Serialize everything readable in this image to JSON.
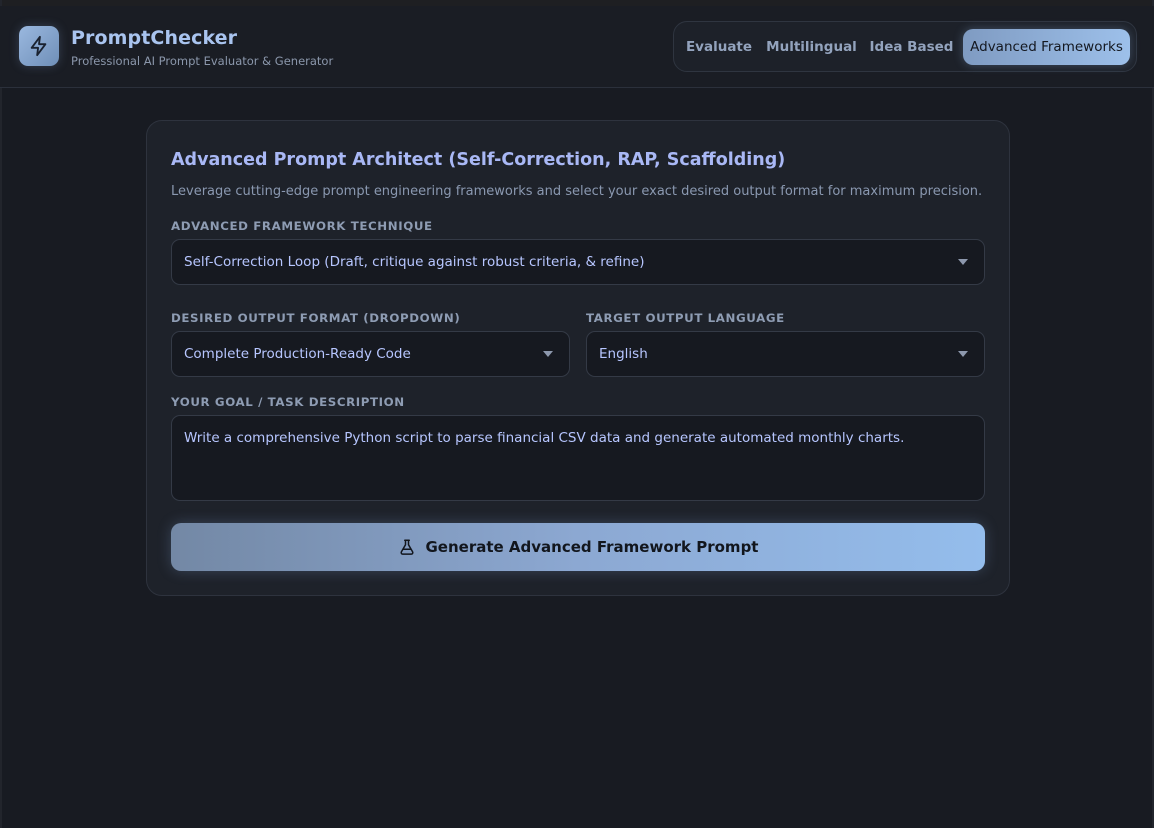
{
  "app": {
    "title": "PromptChecker",
    "subtitle": "Professional AI Prompt Evaluator & Generator",
    "logo_icon": "lightning-bolt-icon"
  },
  "nav": {
    "tabs": [
      {
        "label": "Evaluate",
        "active": false
      },
      {
        "label": "Multilingual",
        "active": false
      },
      {
        "label": "Idea Based",
        "active": false
      },
      {
        "label": "Advanced Frameworks",
        "active": true
      }
    ]
  },
  "card": {
    "title": "Advanced Prompt Architect (Self-Correction, RAP, Scaffolding)",
    "description": "Leverage cutting-edge prompt engineering frameworks and select your exact desired output format for maximum precision.",
    "framework": {
      "label": "ADVANCED FRAMEWORK TECHNIQUE",
      "value": "Self-Correction Loop (Draft, critique against robust criteria, & refine)"
    },
    "output_format": {
      "label": "DESIRED OUTPUT FORMAT (DROPDOWN)",
      "value": "Complete Production-Ready Code"
    },
    "language": {
      "label": "TARGET OUTPUT LANGUAGE",
      "value": "English"
    },
    "goal": {
      "label": "YOUR GOAL / TASK DESCRIPTION",
      "value": "Write a comprehensive Python script to parse financial CSV data and generate automated monthly charts."
    },
    "generate_button": {
      "label": "Generate Advanced Framework Prompt",
      "icon": "flask-icon"
    }
  },
  "colors": {
    "background": "#181b22",
    "card": "#1e222a",
    "accent": "#a9c4ef",
    "accent_title": "#a9b8f5",
    "button_gradient_start": "#7388a5",
    "button_gradient_end": "#94bdec"
  }
}
